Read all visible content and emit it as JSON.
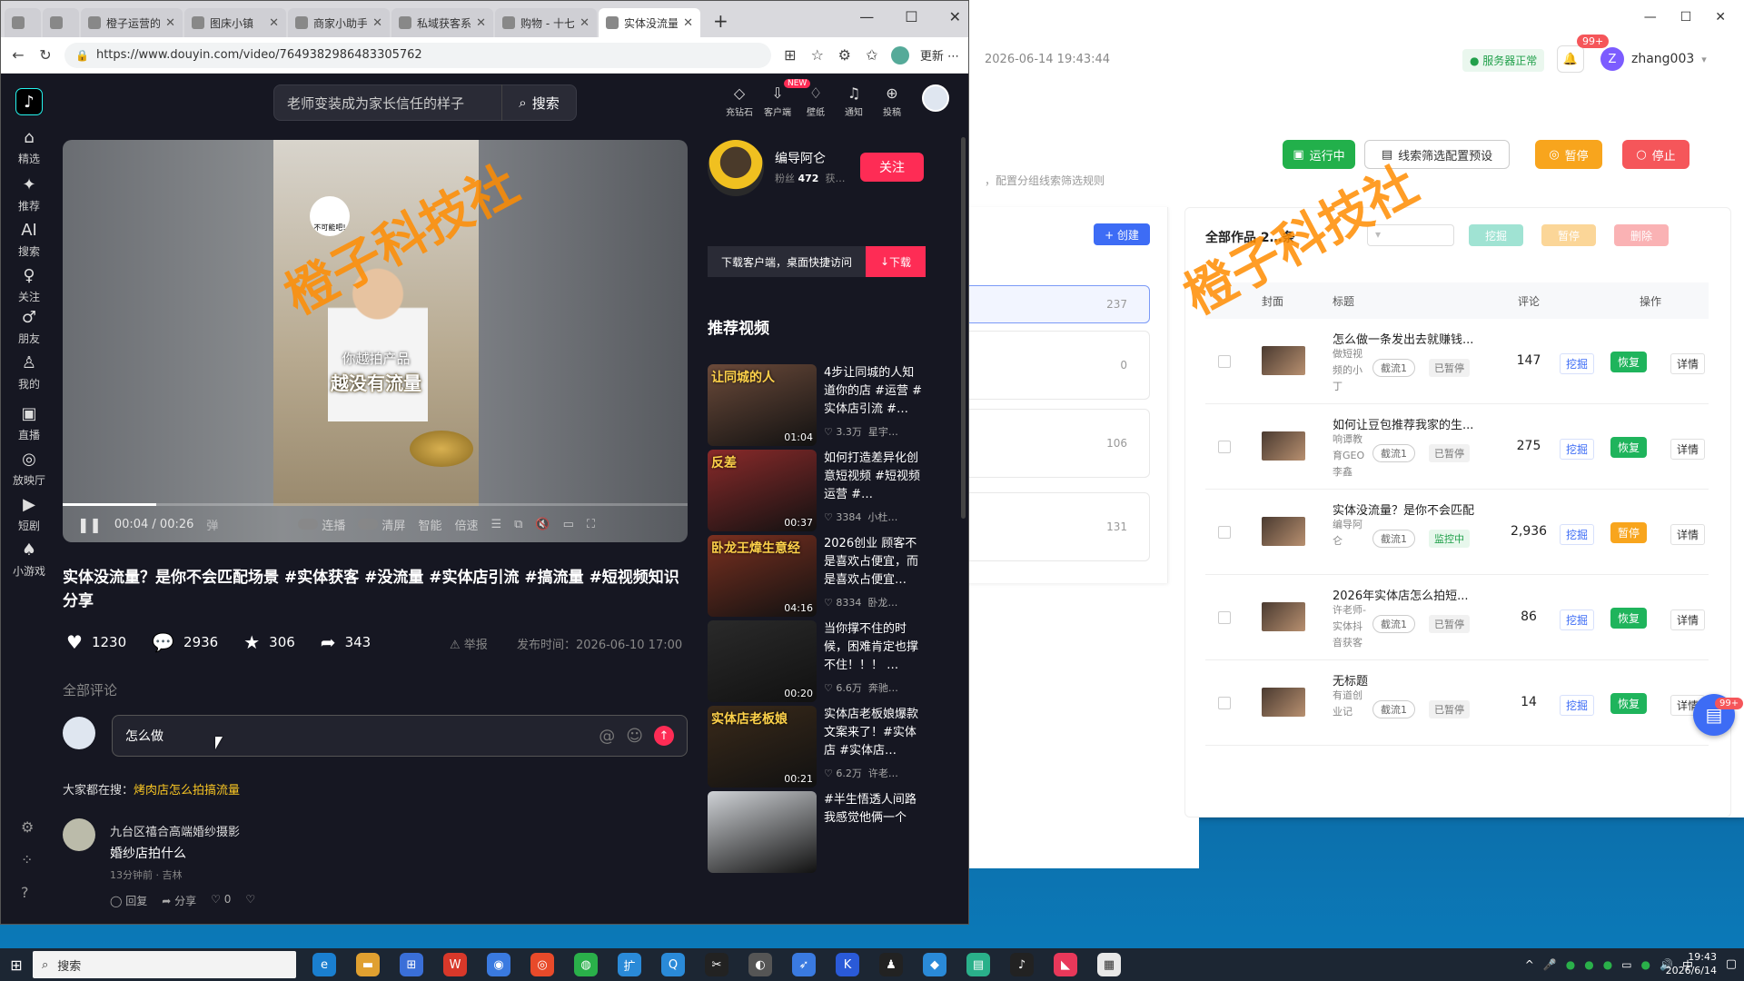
{
  "browser": {
    "tabs": [
      {
        "label": "",
        "icon": "window-icon"
      },
      {
        "label": "",
        "icon": "edge-icon"
      },
      {
        "label": "橙子运营的",
        "icon": "calendar-icon"
      },
      {
        "label": "图床小镇",
        "icon": "image-icon"
      },
      {
        "label": "商家小助手",
        "icon": "gear-icon"
      },
      {
        "label": "私域获客系",
        "icon": "globe-icon"
      },
      {
        "label": "购物 - 十七",
        "icon": "page-icon"
      },
      {
        "label": "实体没流量",
        "icon": "douyin-icon"
      }
    ],
    "url": "https://www.douyin.com/video/7649382986483305762",
    "update_label": "更新"
  },
  "douyin": {
    "sidebar": [
      {
        "label": "精选",
        "icon": "home-icon"
      },
      {
        "label": "推荐",
        "icon": "sparkle-icon"
      },
      {
        "label": "搜索",
        "icon": "ai-icon"
      },
      {
        "label": "关注",
        "icon": "follow-icon"
      },
      {
        "label": "朋友",
        "icon": "friends-icon"
      },
      {
        "label": "我的",
        "icon": "user-icon"
      },
      {
        "label": "直播",
        "icon": "tv-icon"
      },
      {
        "label": "放映厅",
        "icon": "film-icon"
      },
      {
        "label": "短剧",
        "icon": "drama-icon"
      },
      {
        "label": "小游戏",
        "icon": "game-icon"
      }
    ],
    "search": {
      "value": "老师变装成为家长信任的样子",
      "button": "搜索"
    },
    "top_icons": [
      {
        "label": "充钻石",
        "icon": "diamond-icon"
      },
      {
        "label": "客户端",
        "icon": "download-icon"
      },
      {
        "label": "壁纸",
        "icon": "wallpaper-icon"
      },
      {
        "label": "通知",
        "icon": "bell-icon"
      },
      {
        "label": "投稿",
        "icon": "upload-icon"
      }
    ],
    "new_badge": "NEW",
    "video": {
      "caption1": "你越拍产品",
      "caption2": "越没有流量",
      "sticker": "不可能吧!",
      "time": "00:04 / 00:26",
      "progress": 0.15,
      "controls": [
        "连播",
        "清屏",
        "智能",
        "倍速"
      ]
    },
    "title": "实体没流量？是你不会匹配场景 #实体获客 #没流量 #实体店引流 #搞流量 #短视频知识分享",
    "stats": {
      "likes": "1230",
      "comments": "2936",
      "favorites": "306",
      "shares": "343"
    },
    "report": "举报",
    "publish_time": "发布时间：2026-06-10 17:00",
    "all_comments": "全部评论",
    "comment_input": "怎么做",
    "everyone_searching": "大家都在搜：",
    "everyone_link": "烤肉店怎么拍搞流量",
    "comment": {
      "name": "九台区禧合高端婚纱摄影",
      "text": "婚纱店拍什么",
      "meta": "13分钟前 · 吉林",
      "reply": "回复",
      "share": "分享",
      "likes": "0"
    },
    "author": {
      "name": "编导阿仑",
      "fans_label": "粉丝",
      "fans": "472",
      "likes_label": "获…",
      "follow": "关注"
    },
    "download": {
      "text": "下载客户端，桌面快捷访问",
      "button": "下载"
    },
    "recommend_title": "推荐视频",
    "recommend": [
      {
        "text": "4步让同城的人知道你的店 #运营 #实体店引流 #…",
        "likes": "3.3万",
        "author": "星宇…",
        "duration": "01:04",
        "cap": "让同城的人",
        "color": "#6b4a3a"
      },
      {
        "text": "如何打造差异化创意短视频 #短视频运营 #…",
        "likes": "3384",
        "author": "小杜…",
        "duration": "00:37",
        "cap": "反差",
        "color": "#8a2a2a"
      },
      {
        "text": "2026创业 顾客不是喜欢占便宜，而是喜欢占便宜…",
        "likes": "8334",
        "author": "卧龙…",
        "duration": "04:16",
        "cap": "卧龙王煒生意经",
        "color": "#7a3020"
      },
      {
        "text": "当你撑不住的时候，困难肯定也撑不住！！！ …",
        "likes": "6.6万",
        "author": "奔驰…",
        "duration": "00:20",
        "cap": "",
        "color": "#2a2a2a"
      },
      {
        "text": "实体店老板娘爆款文案来了！#实体店 #实体店…",
        "likes": "6.2万",
        "author": "许老…",
        "duration": "00:21",
        "cap": "实体店老板娘",
        "color": "#3a2a1a"
      },
      {
        "text": "#半生悟透人间路 我感觉他俩一个",
        "likes": "",
        "author": "",
        "duration": "",
        "cap": "",
        "color": "#cfd2d6"
      }
    ],
    "side_bottom": [
      "settings-icon",
      "apps-icon",
      "help-icon"
    ]
  },
  "admin": {
    "time": "2026-06-14 19:43:44",
    "service_status": "服务器正常",
    "bell_badge": "99+",
    "user_initial": "Z",
    "username": "zhang003",
    "buttons": {
      "running": "运行中",
      "preset": "线索筛选配置预设",
      "pause": "暂停",
      "stop": "停止"
    },
    "hint": "，配置分组线索筛选规则",
    "create_label": "+ 创建",
    "groups": [
      "237",
      "0",
      "106",
      "131"
    ],
    "works_title": "全部作品 2…条",
    "works_select": "",
    "works_actions": [
      "挖掘",
      "暂停",
      "删除"
    ],
    "columns": {
      "cover": "封面",
      "title": "标题",
      "comments": "评论",
      "ops": "操作"
    },
    "rows": [
      {
        "title": "怎么做一条发出去就赚钱...",
        "author": "做短视频的小丁",
        "tag": "截流1",
        "status": "已暂停",
        "count": "147",
        "mine": "挖掘",
        "action": "恢复",
        "detail": "详情",
        "action_color": "#1fb45c"
      },
      {
        "title": "如何让豆包推荐我家的生...",
        "author": "响谭教育GEO李鑫",
        "tag": "截流1",
        "status": "已暂停",
        "count": "275",
        "mine": "挖掘",
        "action": "恢复",
        "detail": "详情",
        "action_color": "#1fb45c"
      },
      {
        "title": "实体没流量？是你不会匹配",
        "author": "编导阿仑",
        "tag": "截流1",
        "status": "监控中",
        "count": "2,936",
        "mine": "挖掘",
        "action": "暂停",
        "detail": "详情",
        "action_color": "#f8a51d"
      },
      {
        "title": "2026年实体店怎么拍短...",
        "author": "许老师-实体抖音获客",
        "tag": "截流1",
        "status": "已暂停",
        "count": "86",
        "mine": "挖掘",
        "action": "恢复",
        "detail": "详情",
        "action_color": "#1fb45c"
      },
      {
        "title": "无标题",
        "author": "有道创业记",
        "tag": "截流1",
        "status": "已暂停",
        "count": "14",
        "mine": "挖掘",
        "action": "恢复",
        "detail": "详情",
        "action_color": "#1fb45c"
      }
    ],
    "float_badge": "99+"
  },
  "watermark": "橙子科技社",
  "taskbar": {
    "search_placeholder": "搜索",
    "clock_time": "19:43",
    "clock_date": "2026/6/14",
    "ime": "中"
  }
}
